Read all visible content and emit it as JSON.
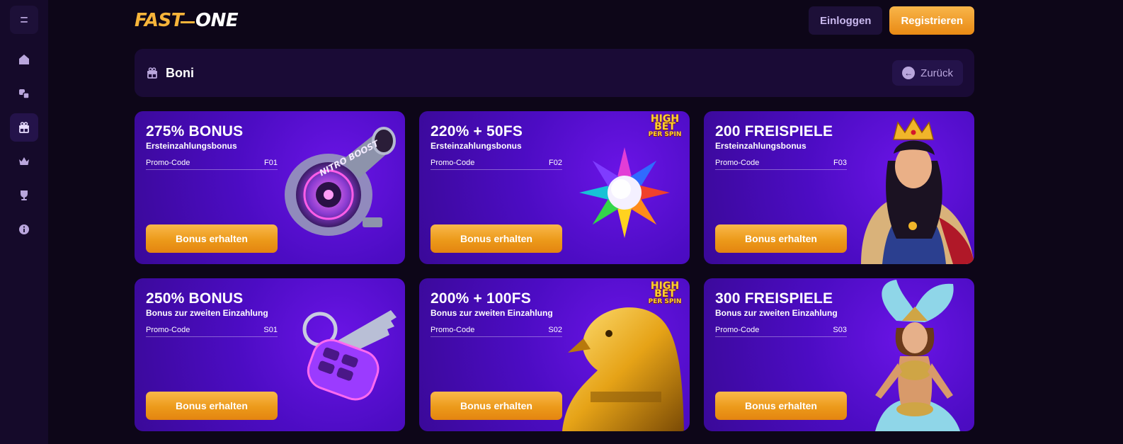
{
  "brand": {
    "part1": "FAST",
    "part2": "ONE"
  },
  "header": {
    "login_label": "Einloggen",
    "register_label": "Registrieren"
  },
  "sidebar": {
    "items": [
      {
        "icon": "menu-icon"
      },
      {
        "icon": "home-icon"
      },
      {
        "icon": "games-icon"
      },
      {
        "icon": "gift-icon",
        "active": true
      },
      {
        "icon": "crown-icon"
      },
      {
        "icon": "trophy-icon"
      },
      {
        "icon": "info-icon"
      }
    ]
  },
  "page": {
    "title": "Boni",
    "back_label": "Zurück"
  },
  "promo_label": "Promo-Code",
  "button_label": "Bonus erhalten",
  "cards": [
    {
      "title": "275% BONUS",
      "subtitle": "Ersteinzahlungsbonus",
      "code": "F01",
      "art": "turbo-image",
      "art_text": "NITRO BOOST"
    },
    {
      "title": "220% + 50FS",
      "subtitle": "Ersteinzahlungsbonus",
      "code": "F02",
      "art": "gem-star-image",
      "badge1": "HIGH BET",
      "badge2": "PER SPIN"
    },
    {
      "title": "200 FREISPIELE",
      "subtitle": "Ersteinzahlungsbonus",
      "code": "F03",
      "art": "queen-image"
    },
    {
      "title": "250% BONUS",
      "subtitle": "Bonus zur zweiten Einzahlung",
      "code": "S01",
      "art": "car-key-image"
    },
    {
      "title": "200% + 100FS",
      "subtitle": "Bonus zur zweiten Einzahlung",
      "code": "S02",
      "art": "golden-falcon-image",
      "badge1": "HIGH BET",
      "badge2": "PER SPIN"
    },
    {
      "title": "300 FREISPIELE",
      "subtitle": "Bonus zur zweiten Einzahlung",
      "code": "S03",
      "art": "showgirl-image"
    }
  ]
}
